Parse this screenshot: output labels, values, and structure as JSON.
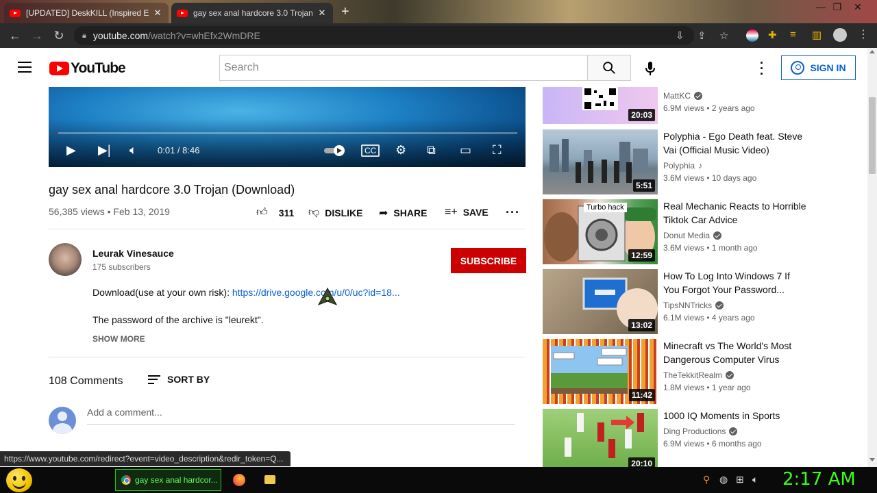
{
  "browser": {
    "tabs": [
      {
        "title": "[UPDATED] DeskKILL (Inspired E",
        "active": false
      },
      {
        "title": "gay sex anal hardcore 3.0 Trojan",
        "active": true
      }
    ],
    "url_host": "youtube.com",
    "url_path": "/watch?v=whEfx2WmDRE",
    "status_url": "https://www.youtube.com/redirect?event=video_description&redir_token=Q..."
  },
  "header": {
    "logo_text": "YouTube",
    "search_placeholder": "Search",
    "signin_label": "SIGN IN"
  },
  "player": {
    "time": "0:01 / 8:46",
    "progress_fraction": 0.002
  },
  "video": {
    "title": "gay sex anal hardcore 3.0 Trojan (Download)",
    "stats": "56,385 views • Feb 13, 2019",
    "likes": "311",
    "dislike_label": "DISLIKE",
    "share_label": "SHARE",
    "save_label": "SAVE"
  },
  "channel": {
    "name": "Leurak Vinesauce",
    "subscribers": "175 subscribers",
    "subscribe_label": "SUBSCRIBE"
  },
  "description": {
    "line1_prefix": "Download(use at your own risk): ",
    "line1_link": "https://drive.google.com/u/0/uc?id=18...",
    "line2": "The password of the archive is \"leurekt\".",
    "show_more": "SHOW MORE"
  },
  "comments": {
    "count": "108 Comments",
    "sort_label": "SORT BY",
    "add_placeholder": "Add a comment..."
  },
  "recommendations": [
    {
      "title": "",
      "channel": "MattKC",
      "meta": "6.9M views • 2 years ago",
      "duration": "20:03",
      "verified": true
    },
    {
      "title": "Polyphia - Ego Death feat. Steve Vai (Official Music Video)",
      "channel": "Polyphia",
      "meta": "3.6M views • 10 days ago",
      "duration": "5:51",
      "music": true
    },
    {
      "title": "Real Mechanic Reacts to Horrible Tiktok Car Advice",
      "channel": "Donut Media",
      "meta": "3.6M views • 1 month ago",
      "duration": "12:59",
      "verified": true,
      "thumb_text": "Turbo hack"
    },
    {
      "title": "How To Log Into Windows 7 If You Forgot Your Password...",
      "channel": "TipsNNTricks",
      "meta": "6.1M views • 4 years ago",
      "duration": "13:02",
      "verified": true
    },
    {
      "title": "Minecraft vs The World's Most Dangerous Computer Virus",
      "channel": "TheTekkitRealm",
      "meta": "1.8M views • 1 year ago",
      "duration": "11:42",
      "verified": true
    },
    {
      "title": "1000 IQ Moments in Sports",
      "channel": "Ding Productions",
      "meta": "6.9M views • 6 months ago",
      "duration": "20:10",
      "verified": true
    }
  ],
  "taskbar": {
    "chrome_task": "gay sex anal hardcor...",
    "clock": "2:17 AM"
  }
}
